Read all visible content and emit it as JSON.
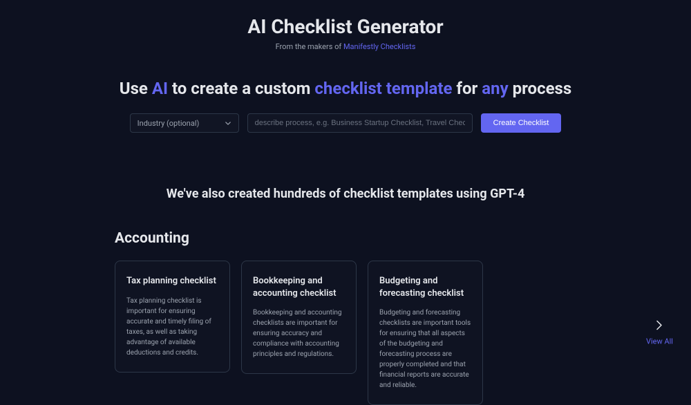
{
  "header": {
    "title": "AI Checklist Generator",
    "subtitle_prefix": "From the makers of ",
    "subtitle_link": "Manifestly Checklists"
  },
  "tagline": {
    "part1": "Use ",
    "highlight1": "AI",
    "part2": " to create a custom ",
    "highlight2": "checklist template",
    "part3": " for ",
    "highlight3": "any",
    "part4": " process"
  },
  "form": {
    "industry_label": "Industry (optional)",
    "process_placeholder": "describe process, e.g. Business Startup Checklist, Travel Checklist, etc",
    "create_button": "Create Checklist"
  },
  "section_heading": "We've also created hundreds of checklist templates using GPT-4",
  "category": {
    "title": "Accounting"
  },
  "cards": [
    {
      "title": "Tax planning checklist",
      "desc": "Tax planning checklist is important for ensuring accurate and timely filing of taxes, as well as taking advantage of available deductions and credits."
    },
    {
      "title": "Bookkeeping and accounting checklist",
      "desc": "Bookkeeping and accounting checklists are important for ensuring accuracy and compliance with accounting principles and regulations."
    },
    {
      "title": "Budgeting and forecasting checklist",
      "desc": "Budgeting and forecasting checklists are important tools for ensuring that all aspects of the budgeting and forecasting process are properly completed and that financial reports are accurate and reliable."
    }
  ],
  "view_all": "View All"
}
